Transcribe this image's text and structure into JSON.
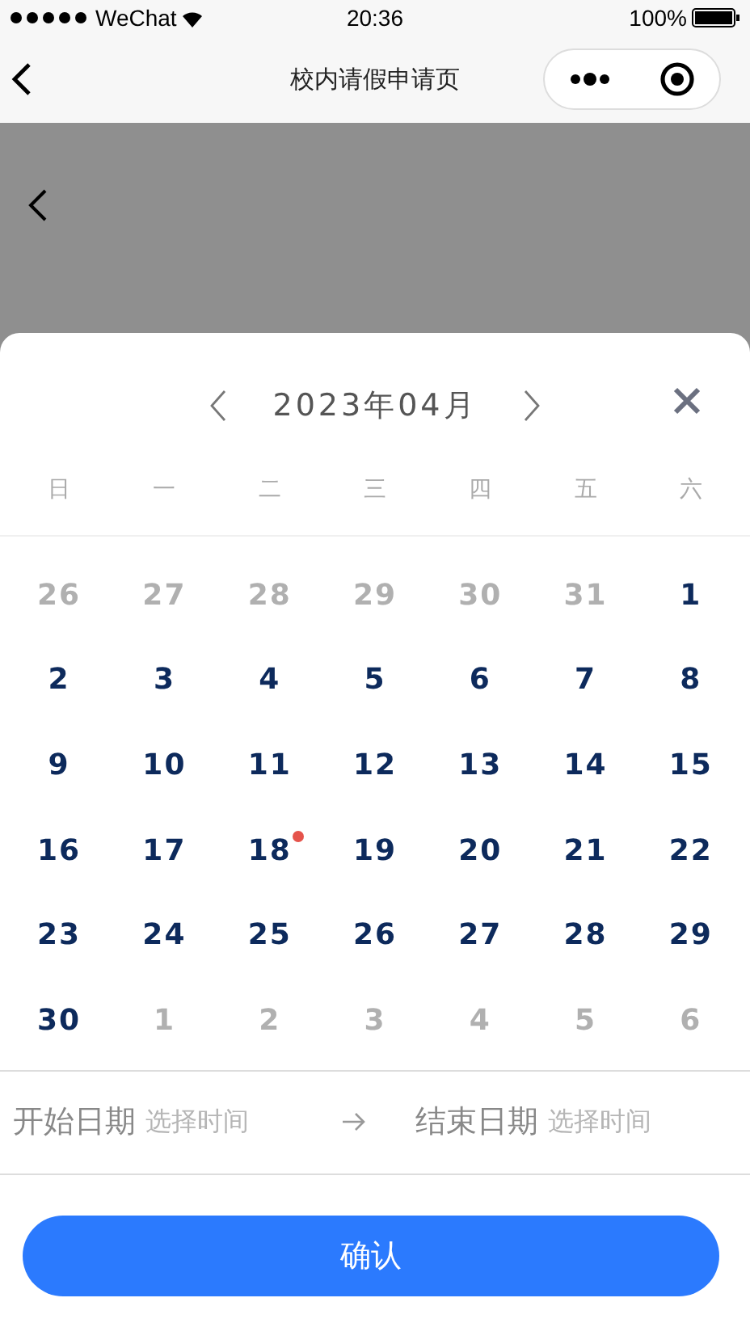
{
  "status_bar": {
    "carrier": "WeChat",
    "time": "20:36",
    "battery": "100%"
  },
  "nav_bar": {
    "title": "校内请假申请页"
  },
  "calendar": {
    "month_label": "2023年04月",
    "weekdays": [
      "日",
      "一",
      "二",
      "三",
      "四",
      "五",
      "六"
    ],
    "days": [
      {
        "day": "26",
        "in_month": false,
        "marked": false
      },
      {
        "day": "27",
        "in_month": false,
        "marked": false
      },
      {
        "day": "28",
        "in_month": false,
        "marked": false
      },
      {
        "day": "29",
        "in_month": false,
        "marked": false
      },
      {
        "day": "30",
        "in_month": false,
        "marked": false
      },
      {
        "day": "31",
        "in_month": false,
        "marked": false
      },
      {
        "day": "1",
        "in_month": true,
        "marked": false
      },
      {
        "day": "2",
        "in_month": true,
        "marked": false
      },
      {
        "day": "3",
        "in_month": true,
        "marked": false
      },
      {
        "day": "4",
        "in_month": true,
        "marked": false
      },
      {
        "day": "5",
        "in_month": true,
        "marked": false
      },
      {
        "day": "6",
        "in_month": true,
        "marked": false
      },
      {
        "day": "7",
        "in_month": true,
        "marked": false
      },
      {
        "day": "8",
        "in_month": true,
        "marked": false
      },
      {
        "day": "9",
        "in_month": true,
        "marked": false
      },
      {
        "day": "10",
        "in_month": true,
        "marked": false
      },
      {
        "day": "11",
        "in_month": true,
        "marked": false
      },
      {
        "day": "12",
        "in_month": true,
        "marked": false
      },
      {
        "day": "13",
        "in_month": true,
        "marked": false
      },
      {
        "day": "14",
        "in_month": true,
        "marked": false
      },
      {
        "day": "15",
        "in_month": true,
        "marked": false
      },
      {
        "day": "16",
        "in_month": true,
        "marked": false
      },
      {
        "day": "17",
        "in_month": true,
        "marked": false
      },
      {
        "day": "18",
        "in_month": true,
        "marked": true
      },
      {
        "day": "19",
        "in_month": true,
        "marked": false
      },
      {
        "day": "20",
        "in_month": true,
        "marked": false
      },
      {
        "day": "21",
        "in_month": true,
        "marked": false
      },
      {
        "day": "22",
        "in_month": true,
        "marked": false
      },
      {
        "day": "23",
        "in_month": true,
        "marked": false
      },
      {
        "day": "24",
        "in_month": true,
        "marked": false
      },
      {
        "day": "25",
        "in_month": true,
        "marked": false
      },
      {
        "day": "26",
        "in_month": true,
        "marked": false
      },
      {
        "day": "27",
        "in_month": true,
        "marked": false
      },
      {
        "day": "28",
        "in_month": true,
        "marked": false
      },
      {
        "day": "29",
        "in_month": true,
        "marked": false
      },
      {
        "day": "30",
        "in_month": true,
        "marked": false
      },
      {
        "day": "1",
        "in_month": false,
        "marked": false
      },
      {
        "day": "2",
        "in_month": false,
        "marked": false
      },
      {
        "day": "3",
        "in_month": false,
        "marked": false
      },
      {
        "day": "4",
        "in_month": false,
        "marked": false
      },
      {
        "day": "5",
        "in_month": false,
        "marked": false
      },
      {
        "day": "6",
        "in_month": false,
        "marked": false
      }
    ]
  },
  "range": {
    "start_label": "开始日期",
    "start_placeholder": "选择时间",
    "end_label": "结束日期",
    "end_placeholder": "选择时间"
  },
  "confirm_button": "确认"
}
